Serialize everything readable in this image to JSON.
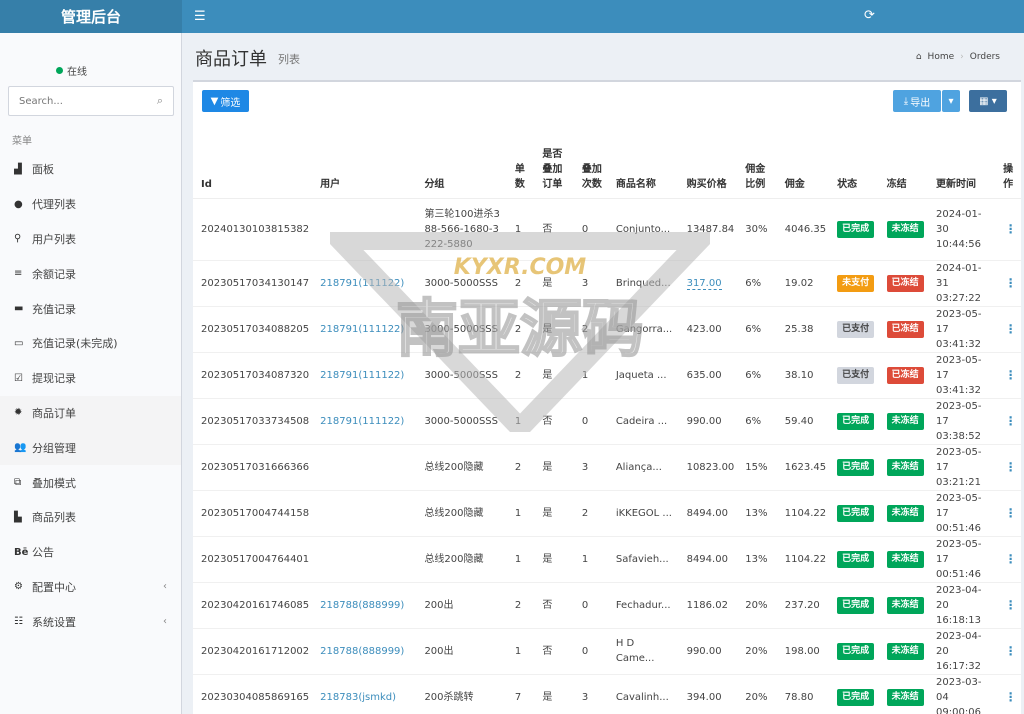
{
  "app": {
    "brand": "管理后台"
  },
  "sidebar": {
    "status": "在线",
    "search_placeholder": "Search...",
    "menu_header": "菜单",
    "items": [
      {
        "label": "面板",
        "icon": "chart-area-icon"
      },
      {
        "label": "代理列表",
        "icon": "circle-icon"
      },
      {
        "label": "用户列表",
        "icon": "sitemap-icon"
      },
      {
        "label": "余额记录",
        "icon": "list-icon"
      },
      {
        "label": "充值记录",
        "icon": "credit-card-icon"
      },
      {
        "label": "充值记录(未完成)",
        "icon": "card-outline-icon"
      },
      {
        "label": "提现记录",
        "icon": "check-square-icon"
      },
      {
        "label": "商品订单",
        "icon": "gear-icon"
      },
      {
        "label": "分组管理",
        "icon": "users-icon"
      },
      {
        "label": "叠加模式",
        "icon": "object-group-icon"
      },
      {
        "label": "商品列表",
        "icon": "bars-chart-icon"
      },
      {
        "label": "公告",
        "icon": "behance-icon"
      },
      {
        "label": "配置中心",
        "icon": "cog-outline-icon"
      },
      {
        "label": "系统设置",
        "icon": "sliders-icon"
      }
    ]
  },
  "header": {
    "title": "商品订单",
    "subtitle": "列表",
    "breadcrumb_home": "Home",
    "breadcrumb_current": "Orders"
  },
  "toolbar": {
    "filter": "筛选",
    "export": "导出"
  },
  "table": {
    "columns": [
      "Id",
      "用户",
      "分组",
      "单数",
      "是否叠加订单",
      "叠加次数",
      "商品名称",
      "购买价格",
      "佣金比例",
      "佣金",
      "状态",
      "冻结",
      "更新时间",
      "操作"
    ],
    "rows": [
      {
        "id": "20240130103815382",
        "user": "",
        "group": "第三轮100进杀388-566-1680-3222-5880",
        "count": "1",
        "stack": "否",
        "stack_times": "0",
        "product": "Conjunto...",
        "price": "13487.84",
        "rate": "30%",
        "commission": "4046.35",
        "status": "已完成",
        "status_color": "#00a65a",
        "frozen": "未冻结",
        "frozen_color": "#00a65a",
        "updated": "2024-01-30 10:44:56"
      },
      {
        "id": "20230517034130147",
        "user": "218791(111122)",
        "group": "3000-5000SSS",
        "count": "2",
        "stack": "是",
        "stack_times": "3",
        "product": "Brinqued...",
        "price": "317.00",
        "rate": "6%",
        "commission": "19.02",
        "status": "未支付",
        "status_color": "#f39c12",
        "frozen": "已冻结",
        "frozen_color": "#dd4b39",
        "updated": "2024-01-31 03:27:22"
      },
      {
        "id": "20230517034088205",
        "user": "218791(111122)",
        "group": "3000-5000SSS",
        "count": "2",
        "stack": "是",
        "stack_times": "2",
        "product": "Gangorra...",
        "price": "423.00",
        "rate": "6%",
        "commission": "25.38",
        "status": "已支付",
        "status_color": "#d2d6de",
        "frozen": "已冻结",
        "frozen_color": "#dd4b39",
        "updated": "2023-05-17 03:41:32"
      },
      {
        "id": "20230517034087320",
        "user": "218791(111122)",
        "group": "3000-5000SSS",
        "count": "2",
        "stack": "是",
        "stack_times": "1",
        "product": "Jaqueta ...",
        "price": "635.00",
        "rate": "6%",
        "commission": "38.10",
        "status": "已支付",
        "status_color": "#d2d6de",
        "frozen": "已冻结",
        "frozen_color": "#dd4b39",
        "updated": "2023-05-17 03:41:32"
      },
      {
        "id": "20230517033734508",
        "user": "218791(111122)",
        "group": "3000-5000SSS",
        "count": "1",
        "stack": "否",
        "stack_times": "0",
        "product": "Cadeira ...",
        "price": "990.00",
        "rate": "6%",
        "commission": "59.40",
        "status": "已完成",
        "status_color": "#00a65a",
        "frozen": "未冻结",
        "frozen_color": "#00a65a",
        "updated": "2023-05-17 03:38:52"
      },
      {
        "id": "20230517031666366",
        "user": "",
        "group": "总线200隐藏",
        "count": "2",
        "stack": "是",
        "stack_times": "3",
        "product": "Aliança...",
        "price": "10823.00",
        "rate": "15%",
        "commission": "1623.45",
        "status": "已完成",
        "status_color": "#00a65a",
        "frozen": "未冻结",
        "frozen_color": "#00a65a",
        "updated": "2023-05-17 03:21:21"
      },
      {
        "id": "20230517004744158",
        "user": "",
        "group": "总线200隐藏",
        "count": "1",
        "stack": "是",
        "stack_times": "2",
        "product": "iKKEGOL ...",
        "price": "8494.00",
        "rate": "13%",
        "commission": "1104.22",
        "status": "已完成",
        "status_color": "#00a65a",
        "frozen": "未冻结",
        "frozen_color": "#00a65a",
        "updated": "2023-05-17 00:51:46"
      },
      {
        "id": "20230517004764401",
        "user": "",
        "group": "总线200隐藏",
        "count": "1",
        "stack": "是",
        "stack_times": "1",
        "product": "Safavieh...",
        "price": "8494.00",
        "rate": "13%",
        "commission": "1104.22",
        "status": "已完成",
        "status_color": "#00a65a",
        "frozen": "未冻结",
        "frozen_color": "#00a65a",
        "updated": "2023-05-17 00:51:46"
      },
      {
        "id": "20230420161746085",
        "user": "218788(888999)",
        "group": "200出",
        "count": "2",
        "stack": "否",
        "stack_times": "0",
        "product": "Fechadur...",
        "price": "1186.02",
        "rate": "20%",
        "commission": "237.20",
        "status": "已完成",
        "status_color": "#00a65a",
        "frozen": "未冻结",
        "frozen_color": "#00a65a",
        "updated": "2023-04-20 16:18:13"
      },
      {
        "id": "20230420161712002",
        "user": "218788(888999)",
        "group": "200出",
        "count": "1",
        "stack": "否",
        "stack_times": "0",
        "product": "H D Came...",
        "price": "990.00",
        "rate": "20%",
        "commission": "198.00",
        "status": "已完成",
        "status_color": "#00a65a",
        "frozen": "未冻结",
        "frozen_color": "#00a65a",
        "updated": "2023-04-20 16:17:32"
      },
      {
        "id": "20230304085869165",
        "user": "218783(jsmkd)",
        "group": "200杀跳转",
        "count": "7",
        "stack": "是",
        "stack_times": "3",
        "product": "Cavalinh...",
        "price": "394.00",
        "rate": "20%",
        "commission": "78.80",
        "status": "已完成",
        "status_color": "#00a65a",
        "frozen": "未冻结",
        "frozen_color": "#00a65a",
        "updated": "2023-03-04 09:00:06"
      }
    ]
  },
  "watermark": {
    "url": "KYXR.COM",
    "text": "南亚源码"
  }
}
